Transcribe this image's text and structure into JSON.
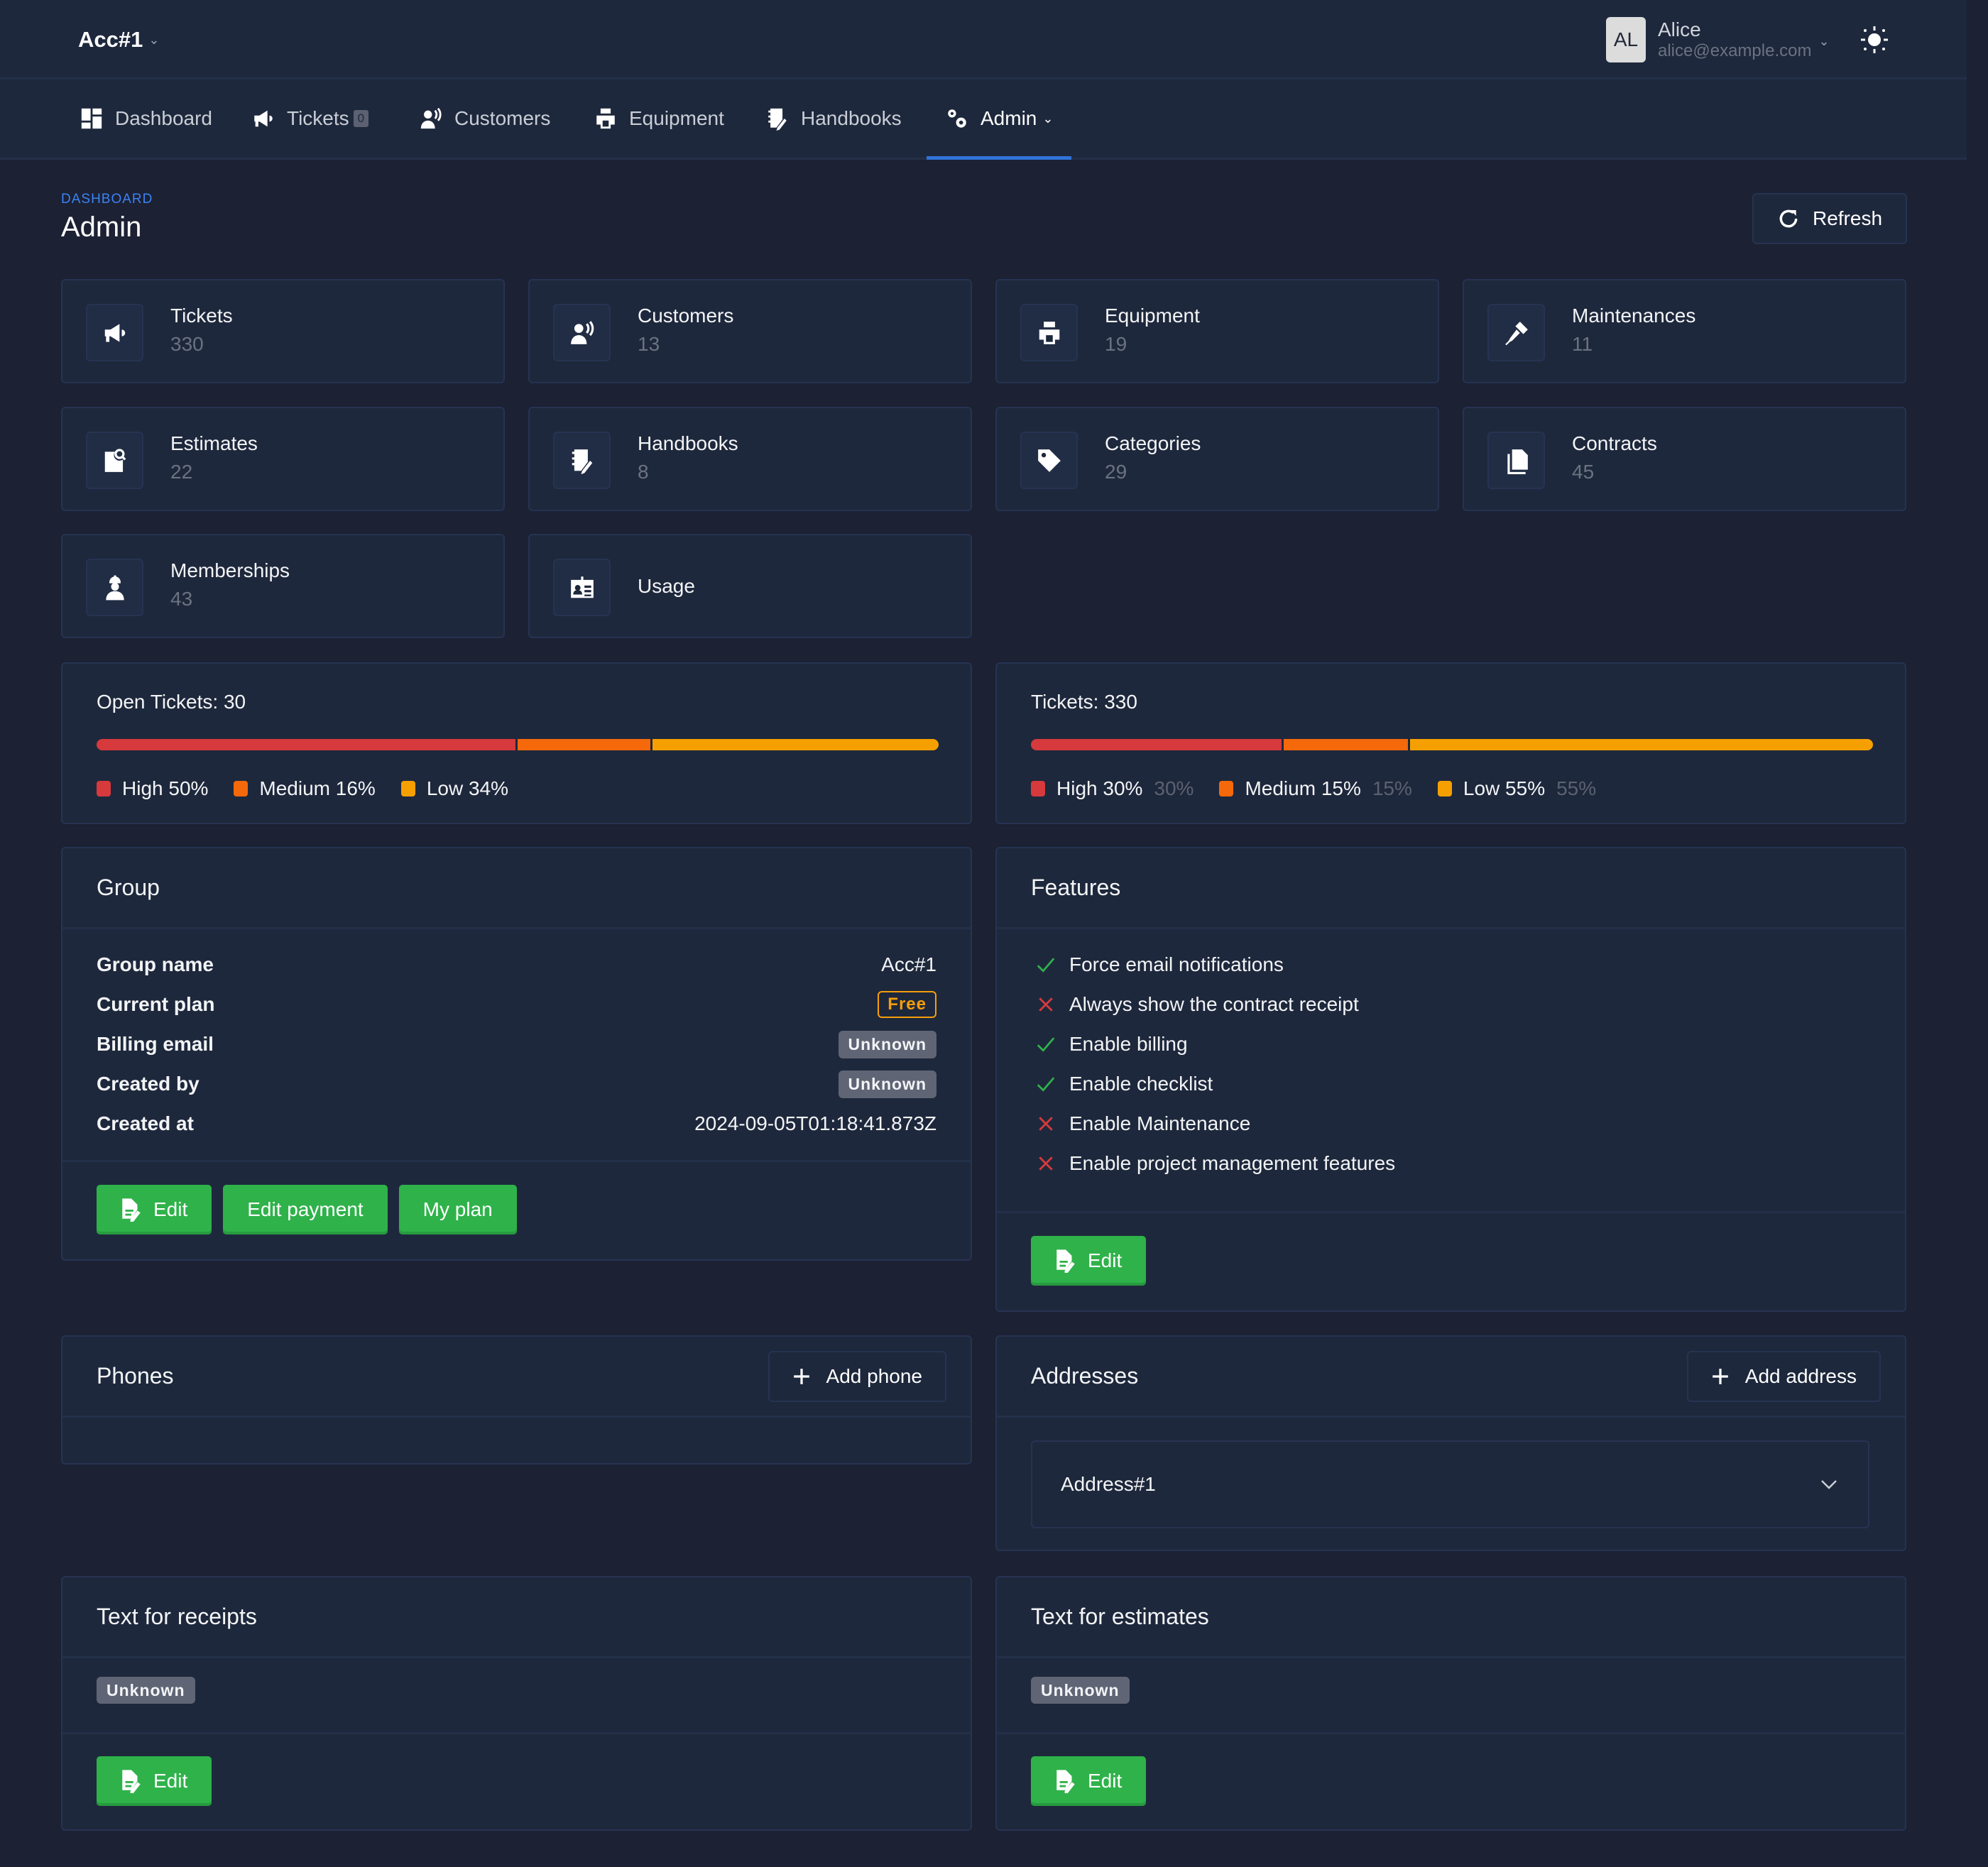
{
  "topbar": {
    "account": "Acc#1",
    "user": {
      "initials": "AL",
      "name": "Alice",
      "email": "alice@example.com"
    },
    "theme_icon": "sun-icon"
  },
  "nav": {
    "items": [
      {
        "label": "Dashboard",
        "icon": "dashboard-icon"
      },
      {
        "label": "Tickets",
        "icon": "megaphone-icon",
        "badge": "0"
      },
      {
        "label": "Customers",
        "icon": "customer-voice-icon"
      },
      {
        "label": "Equipment",
        "icon": "printer-icon"
      },
      {
        "label": "Handbooks",
        "icon": "handbook-icon"
      },
      {
        "label": "Admin",
        "icon": "gears-icon",
        "active": true
      }
    ]
  },
  "page": {
    "breadcrumb": "DASHBOARD",
    "title": "Admin",
    "refresh_label": "Refresh"
  },
  "stats": [
    {
      "label": "Tickets",
      "value": "330",
      "icon": "megaphone-icon"
    },
    {
      "label": "Customers",
      "value": "13",
      "icon": "customer-voice-icon"
    },
    {
      "label": "Equipment",
      "value": "19",
      "icon": "printer-icon"
    },
    {
      "label": "Maintenances",
      "value": "11",
      "icon": "screwdriver-icon"
    },
    {
      "label": "Estimates",
      "value": "22",
      "icon": "file-search-icon"
    },
    {
      "label": "Handbooks",
      "value": "8",
      "icon": "handbook-icon"
    },
    {
      "label": "Categories",
      "value": "29",
      "icon": "tag-icon"
    },
    {
      "label": "Contracts",
      "value": "45",
      "icon": "copy-icon"
    },
    {
      "label": "Memberships",
      "value": "43",
      "icon": "worker-icon"
    },
    {
      "label": "Usage",
      "icon": "id-card-icon"
    }
  ],
  "colors": {
    "high": "#d63a3c",
    "medium": "#f5690a",
    "low": "#f5a000",
    "accent": "#2f73d8",
    "success": "#2fb24a"
  },
  "open_tickets": {
    "title": "Open Tickets: 30",
    "segments": [
      {
        "label": "High 50%",
        "percent": 50,
        "color": "#d63a3c"
      },
      {
        "label": "Medium 16%",
        "percent": 16,
        "color": "#f5690a"
      },
      {
        "label": "Low 34%",
        "percent": 34,
        "color": "#f5a000"
      }
    ]
  },
  "all_tickets": {
    "title": "Tickets: 330",
    "segments": [
      {
        "label": "High 30%",
        "extra": "30%",
        "percent": 30,
        "color": "#d63a3c"
      },
      {
        "label": "Medium 15%",
        "extra": "15%",
        "percent": 15,
        "color": "#f5690a"
      },
      {
        "label": "Low 55%",
        "extra": "55%",
        "percent": 55,
        "color": "#f5a000"
      }
    ]
  },
  "group": {
    "title": "Group",
    "rows": [
      {
        "key": "Group name",
        "value": "Acc#1"
      },
      {
        "key": "Current plan",
        "value": "Free"
      },
      {
        "key": "Billing email",
        "value": "Unknown"
      },
      {
        "key": "Created by",
        "value": "Unknown"
      },
      {
        "key": "Created at",
        "value": "2024-09-05T01:18:41.873Z"
      }
    ],
    "buttons": {
      "edit": "Edit",
      "edit_payment": "Edit payment",
      "my_plan": "My plan"
    }
  },
  "features": {
    "title": "Features",
    "items": [
      {
        "label": "Force email notifications",
        "enabled": true
      },
      {
        "label": "Always show the contract receipt",
        "enabled": false
      },
      {
        "label": "Enable billing",
        "enabled": true
      },
      {
        "label": "Enable checklist",
        "enabled": true
      },
      {
        "label": "Enable Maintenance",
        "enabled": false
      },
      {
        "label": "Enable project management features",
        "enabled": false
      }
    ],
    "edit_label": "Edit"
  },
  "phones": {
    "title": "Phones",
    "add_label": "Add phone"
  },
  "addresses": {
    "title": "Addresses",
    "add_label": "Add address",
    "items": [
      "Address#1"
    ]
  },
  "receipts": {
    "title": "Text for receipts",
    "value": "Unknown",
    "edit_label": "Edit"
  },
  "estimates": {
    "title": "Text for estimates",
    "value": "Unknown",
    "edit_label": "Edit"
  }
}
